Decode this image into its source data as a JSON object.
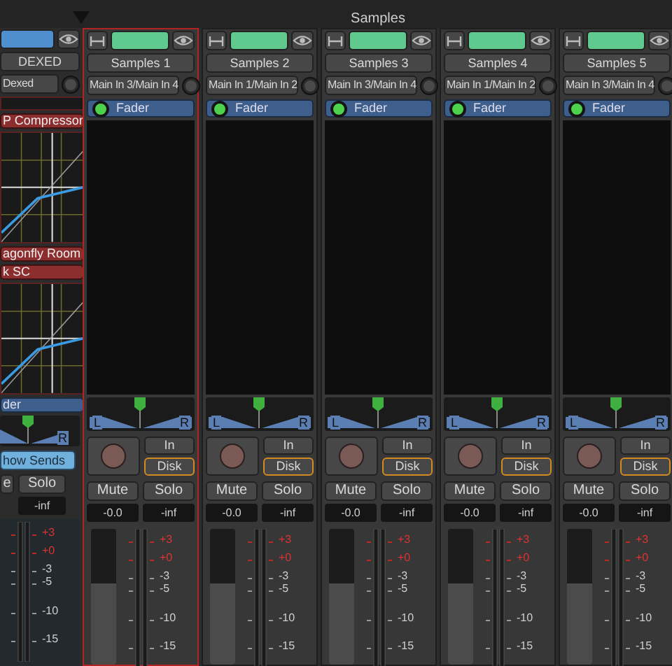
{
  "group_label": "Samples",
  "left_strip": {
    "name": "DEXED",
    "color": "#4f8fd0",
    "input": "Dexed",
    "processors": [
      {
        "kind": "blank"
      },
      {
        "kind": "plugin",
        "label": "P Compressor"
      },
      {
        "kind": "graph"
      },
      {
        "kind": "plugin",
        "label": "agonfly Room"
      },
      {
        "kind": "plugin",
        "label": "k SC"
      },
      {
        "kind": "graph"
      },
      {
        "kind": "fader",
        "label": "der"
      }
    ],
    "panner_right": "R",
    "sends": "how Sends",
    "mute": "e",
    "solo": "Solo",
    "peak": "-inf",
    "meter_scale": [
      {
        "label": "+3",
        "hot": true
      },
      {
        "label": "+0",
        "hot": true
      },
      {
        "label": "-3",
        "hot": false
      },
      {
        "label": "-5",
        "hot": false
      },
      {
        "label": "-10",
        "hot": false
      },
      {
        "label": "-15",
        "hot": false
      }
    ]
  },
  "strips": [
    {
      "name": "Samples 1",
      "color": "#5fc98e",
      "selected": true,
      "input": "Main In 3/Main In 4",
      "processor": "Fader",
      "panner_left": "L",
      "panner_right": "R",
      "monitor_in": "In",
      "monitor_disk": "Disk",
      "disk_active": true,
      "mute": "Mute",
      "solo": "Solo",
      "gain": "-0.0",
      "peak": "-inf",
      "level": 0.6,
      "meter_scale": [
        {
          "label": "+3",
          "hot": true
        },
        {
          "label": "+0",
          "hot": true
        },
        {
          "label": "-3",
          "hot": false
        },
        {
          "label": "-5",
          "hot": false
        },
        {
          "label": "-10",
          "hot": false
        },
        {
          "label": "-15",
          "hot": false
        }
      ]
    },
    {
      "name": "Samples 2",
      "color": "#5fc98e",
      "selected": false,
      "input": "Main In 1/Main In 2",
      "processor": "Fader",
      "panner_left": "L",
      "panner_right": "R",
      "monitor_in": "In",
      "monitor_disk": "Disk",
      "disk_active": true,
      "mute": "Mute",
      "solo": "Solo",
      "gain": "-0.0",
      "peak": "-inf",
      "level": 0.6,
      "meter_scale": [
        {
          "label": "+3",
          "hot": true
        },
        {
          "label": "+0",
          "hot": true
        },
        {
          "label": "-3",
          "hot": false
        },
        {
          "label": "-5",
          "hot": false
        },
        {
          "label": "-10",
          "hot": false
        },
        {
          "label": "-15",
          "hot": false
        }
      ]
    },
    {
      "name": "Samples 3",
      "color": "#5fc98e",
      "selected": false,
      "input": "Main In 3/Main In 4",
      "processor": "Fader",
      "panner_left": "L",
      "panner_right": "R",
      "monitor_in": "In",
      "monitor_disk": "Disk",
      "disk_active": true,
      "mute": "Mute",
      "solo": "Solo",
      "gain": "-0.0",
      "peak": "-inf",
      "level": 0.6,
      "meter_scale": [
        {
          "label": "+3",
          "hot": true
        },
        {
          "label": "+0",
          "hot": true
        },
        {
          "label": "-3",
          "hot": false
        },
        {
          "label": "-5",
          "hot": false
        },
        {
          "label": "-10",
          "hot": false
        },
        {
          "label": "-15",
          "hot": false
        }
      ]
    },
    {
      "name": "Samples 4",
      "color": "#5fc98e",
      "selected": false,
      "input": "Main In 1/Main In 2",
      "processor": "Fader",
      "panner_left": "L",
      "panner_right": "R",
      "monitor_in": "In",
      "monitor_disk": "Disk",
      "disk_active": true,
      "mute": "Mute",
      "solo": "Solo",
      "gain": "-0.0",
      "peak": "-inf",
      "level": 0.6,
      "meter_scale": [
        {
          "label": "+3",
          "hot": true
        },
        {
          "label": "+0",
          "hot": true
        },
        {
          "label": "-3",
          "hot": false
        },
        {
          "label": "-5",
          "hot": false
        },
        {
          "label": "-10",
          "hot": false
        },
        {
          "label": "-15",
          "hot": false
        }
      ]
    },
    {
      "name": "Samples 5",
      "color": "#5fc98e",
      "selected": false,
      "input": "Main In 3/Main In 4",
      "processor": "Fader",
      "panner_left": "L",
      "panner_right": "R",
      "monitor_in": "In",
      "monitor_disk": "Disk",
      "disk_active": true,
      "mute": "Mute",
      "solo": "Solo",
      "gain": "-0.0",
      "peak": "-inf",
      "level": 0.6,
      "meter_scale": [
        {
          "label": "+3",
          "hot": true
        },
        {
          "label": "+0",
          "hot": true
        },
        {
          "label": "-3",
          "hot": false
        },
        {
          "label": "-5",
          "hot": false
        },
        {
          "label": "-10",
          "hot": false
        },
        {
          "label": "-15",
          "hot": false
        }
      ]
    }
  ]
}
